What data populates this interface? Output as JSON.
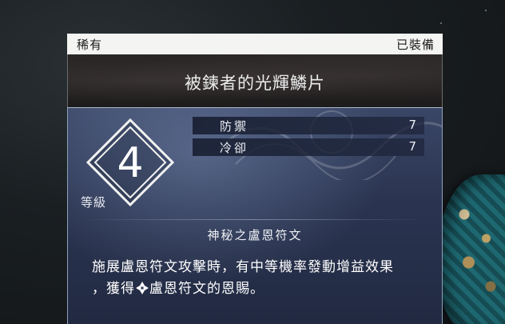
{
  "tooltip": {
    "rarity": "稀有",
    "equipped_status": "已裝備",
    "item_name": "被鍊者的光輝鱗片",
    "level": {
      "value": "4",
      "label": "等級"
    },
    "stats": [
      {
        "name": "防禦",
        "value": "7"
      },
      {
        "name": "冷卻",
        "value": "7"
      }
    ],
    "effect": {
      "title": "神秘之盧恩符文",
      "line1": "施展盧恩符文攻擊時，有中等機率發動增益效果",
      "line2_prefix": "，獲得",
      "line2_suffix": "盧恩符文的恩賜。",
      "icon": "rune-icon"
    }
  },
  "colors": {
    "header_bg": "#f4f4f2",
    "title_band_bg": "#1d1b1b",
    "body_bg": "#2a3450",
    "text_light": "#eef0f5"
  }
}
